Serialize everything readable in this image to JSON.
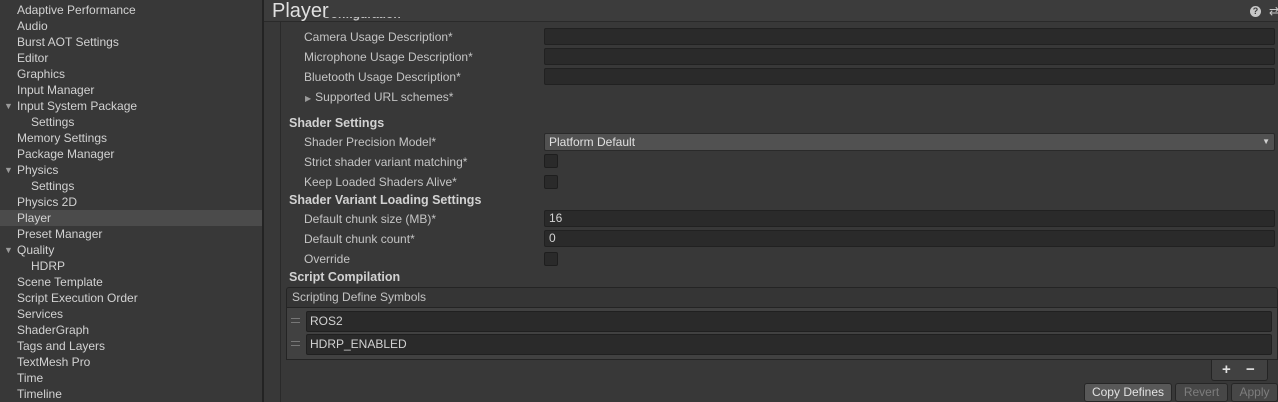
{
  "sidebar": {
    "items": [
      {
        "label": "Adaptive Performance",
        "level": 0,
        "expanded": null,
        "selected": false
      },
      {
        "label": "Audio",
        "level": 0,
        "expanded": null,
        "selected": false
      },
      {
        "label": "Burst AOT Settings",
        "level": 0,
        "expanded": null,
        "selected": false
      },
      {
        "label": "Editor",
        "level": 0,
        "expanded": null,
        "selected": false
      },
      {
        "label": "Graphics",
        "level": 0,
        "expanded": null,
        "selected": false
      },
      {
        "label": "Input Manager",
        "level": 0,
        "expanded": null,
        "selected": false
      },
      {
        "label": "Input System Package",
        "level": 0,
        "expanded": true,
        "selected": false
      },
      {
        "label": "Settings",
        "level": 1,
        "expanded": null,
        "selected": false
      },
      {
        "label": "Memory Settings",
        "level": 0,
        "expanded": null,
        "selected": false
      },
      {
        "label": "Package Manager",
        "level": 0,
        "expanded": null,
        "selected": false
      },
      {
        "label": "Physics",
        "level": 0,
        "expanded": true,
        "selected": false
      },
      {
        "label": "Settings",
        "level": 1,
        "expanded": null,
        "selected": false
      },
      {
        "label": "Physics 2D",
        "level": 0,
        "expanded": null,
        "selected": false
      },
      {
        "label": "Player",
        "level": 0,
        "expanded": null,
        "selected": true
      },
      {
        "label": "Preset Manager",
        "level": 0,
        "expanded": null,
        "selected": false
      },
      {
        "label": "Quality",
        "level": 0,
        "expanded": true,
        "selected": false
      },
      {
        "label": "HDRP",
        "level": 1,
        "expanded": null,
        "selected": false
      },
      {
        "label": "Scene Template",
        "level": 0,
        "expanded": null,
        "selected": false
      },
      {
        "label": "Script Execution Order",
        "level": 0,
        "expanded": null,
        "selected": false
      },
      {
        "label": "Services",
        "level": 0,
        "expanded": null,
        "selected": false
      },
      {
        "label": "ShaderGraph",
        "level": 0,
        "expanded": null,
        "selected": false
      },
      {
        "label": "Tags and Layers",
        "level": 0,
        "expanded": null,
        "selected": false
      },
      {
        "label": "TextMesh Pro",
        "level": 0,
        "expanded": null,
        "selected": false
      },
      {
        "label": "Time",
        "level": 0,
        "expanded": null,
        "selected": false
      },
      {
        "label": "Timeline",
        "level": 0,
        "expanded": null,
        "selected": false
      }
    ]
  },
  "header": {
    "title": "Player",
    "help_icon": "question-mark-icon",
    "help_glyph": "?",
    "preset_icon": "sliders-icon",
    "preset_glyph": "⇄"
  },
  "usage": {
    "camera_label": "Camera Usage Description*",
    "camera_value": "",
    "microphone_label": "Microphone Usage Description*",
    "microphone_value": "",
    "bluetooth_label": "Bluetooth Usage Description*",
    "bluetooth_value": "",
    "url_schemes_label": "Supported URL schemes*"
  },
  "shader_settings": {
    "heading": "Shader Settings",
    "precision_label": "Shader Precision Model*",
    "precision_value": "Platform Default",
    "strict_label": "Strict shader variant matching*",
    "strict_checked": false,
    "keep_loaded_label": "Keep Loaded Shaders Alive*",
    "keep_loaded_checked": false
  },
  "variant_loading": {
    "heading": "Shader Variant Loading Settings",
    "chunk_size_label": "Default chunk size (MB)*",
    "chunk_size_value": "16",
    "chunk_count_label": "Default chunk count*",
    "chunk_count_value": "0",
    "override_label": "Override",
    "override_checked": false
  },
  "script_compilation": {
    "heading": "Script Compilation",
    "list_header": "Scripting Define Symbols",
    "defines": [
      "ROS2",
      "HDRP_ENABLED"
    ],
    "add_glyph": "+",
    "remove_glyph": "−"
  },
  "buttons": {
    "copy_defines": "Copy Defines",
    "revert": "Revert",
    "apply": "Apply"
  },
  "colors": {
    "background": "#383838",
    "field": "#2a2a2a",
    "selected_row": "#4b4b4b"
  }
}
